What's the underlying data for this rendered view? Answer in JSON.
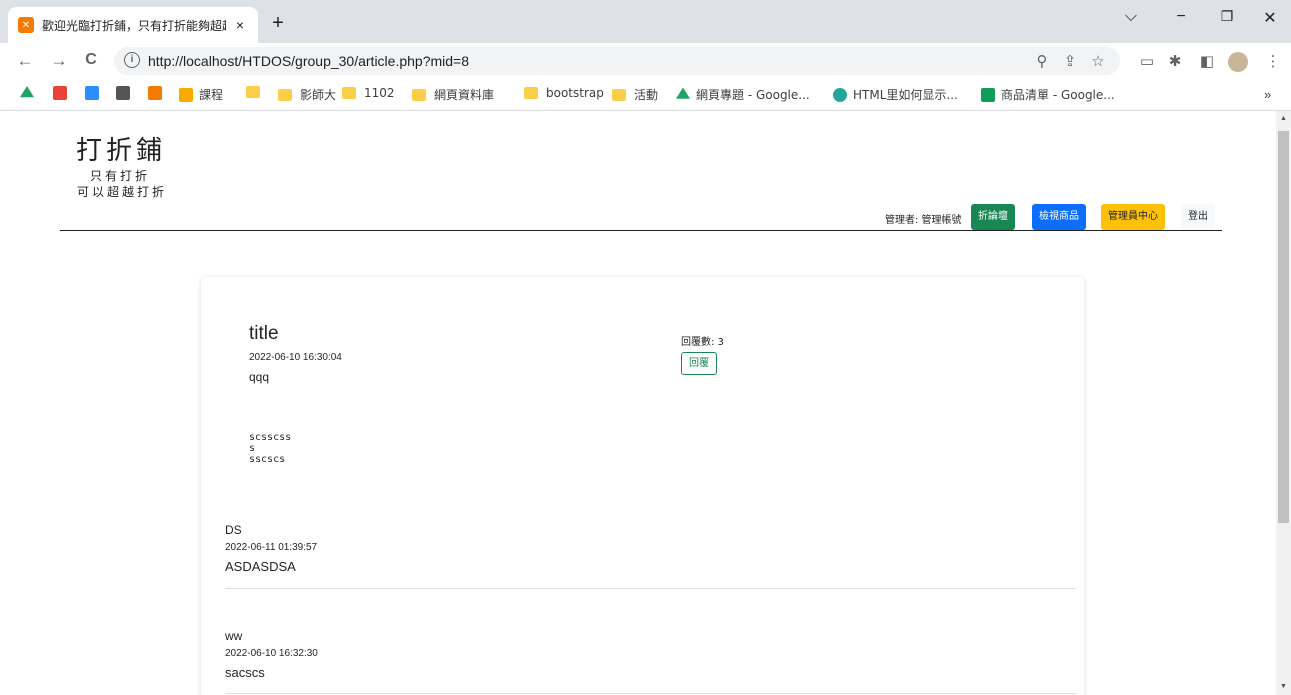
{
  "browser": {
    "tab_title": "歡迎光臨打折鋪，只有打折能夠超越",
    "tab_close": "×",
    "new_tab": "+",
    "window_controls": [
      "⌵",
      "−",
      "❐",
      "✕"
    ],
    "url": "http://localhost/HTDOS/group_30/article.php?mid=8",
    "nav": {
      "back": "←",
      "forward": "→",
      "reload": "C"
    },
    "omnibox_icons": [
      "zoom-icon",
      "share-icon",
      "star-icon"
    ],
    "toolbar_icons": [
      "cast-icon",
      "extensions-icon",
      "sidepanel-icon",
      "profile-avatar",
      "menu-icon"
    ],
    "bookmarks": [
      {
        "label": "",
        "icon": "google-drive-icon",
        "color": "#1fa463"
      },
      {
        "label": "",
        "icon": "gmail-icon",
        "color": "#ea4335"
      },
      {
        "label": "",
        "icon": "zoom-icon",
        "color": "#2d8cff"
      },
      {
        "label": "",
        "icon": "docs-icon",
        "color": "#555555"
      },
      {
        "label": "",
        "icon": "xampp-icon",
        "color": "#f57c00"
      },
      {
        "label": "課程",
        "icon": "classroom-icon",
        "color": "#f9ab00"
      },
      {
        "label": "",
        "icon": "folder-icon",
        "color": "#f9cf4a"
      },
      {
        "label": "影師大",
        "icon": "folder-icon",
        "color": "#f9cf4a"
      },
      {
        "label": "1102",
        "icon": "folder-icon",
        "color": "#f9cf4a"
      },
      {
        "label": "網頁資料庫",
        "icon": "folder-icon",
        "color": "#f9cf4a"
      },
      {
        "label": "bootstrap",
        "icon": "folder-icon",
        "color": "#f9cf4a"
      },
      {
        "label": "活動",
        "icon": "folder-icon",
        "color": "#f9cf4a"
      },
      {
        "label": "網頁專題 - Google...",
        "icon": "google-drive-icon",
        "color": "#1fa463"
      },
      {
        "label": "HTML里如何显示...",
        "icon": "cloud-icon",
        "color": "#26a69a"
      },
      {
        "label": "商品清單 - Google...",
        "icon": "sheets-icon",
        "color": "#0f9d58"
      }
    ],
    "bookmarks_more": "»"
  },
  "header": {
    "logo_title": "打折鋪",
    "logo_sub1": "只有打折",
    "logo_sub2": "可以超越打折",
    "admin_label": "管理者: 管理帳號",
    "buttons": {
      "forum": "折論壇",
      "products": "檢視商品",
      "admin_center": "管理員中心",
      "logout": "登出"
    }
  },
  "article": {
    "title": "title",
    "date": "2022-06-10 16:30:04",
    "body": "qqq",
    "reply_count": "回覆數: 3",
    "reply_button": "回覆",
    "extra_lines": [
      "scsscss",
      "s",
      "sscscs"
    ]
  },
  "replies": [
    {
      "author": "DS",
      "date": "2022-06-11 01:39:57",
      "body": "ASDASDSA"
    },
    {
      "author": "ww",
      "date": "2022-06-10 16:32:30",
      "body": "sacscs"
    }
  ],
  "colors": {
    "success": "#198754",
    "primary": "#0d6efd",
    "warning": "#ffc107",
    "light": "#f8f9fa"
  }
}
